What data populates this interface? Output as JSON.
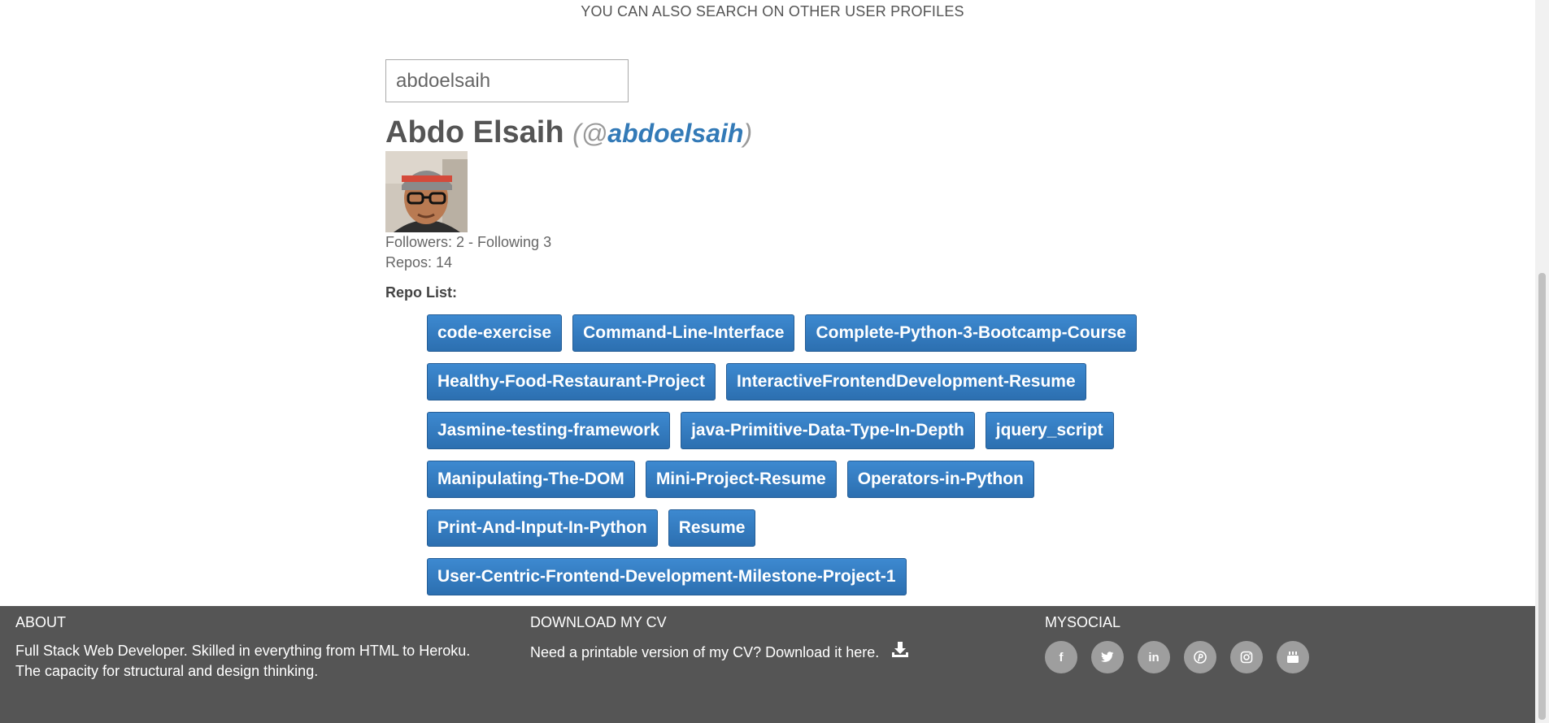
{
  "search": {
    "heading": "YOU CAN ALSO SEARCH ON OTHER USER PROFILES",
    "value": "abdoelsaih"
  },
  "profile": {
    "name": "Abdo Elsaih",
    "paren_open": "(@",
    "handle": "abdoelsaih",
    "paren_close": ")",
    "avatar_icon": "user-avatar-photo",
    "followers_text": "Followers: 2 - Following 3",
    "repos_text": "Repos: 14"
  },
  "repos": {
    "label": "Repo List:",
    "items": [
      "code-exercise",
      "Command-Line-Interface",
      "Complete-Python-3-Bootcamp-Course",
      "Healthy-Food-Restaurant-Project",
      "InteractiveFrontendDevelopment-Resume",
      "Jasmine-testing-framework",
      "java-Primitive-Data-Type-In-Depth",
      "jquery_script",
      "Manipulating-The-DOM",
      "Mini-Project-Resume",
      "Operators-in-Python",
      "Print-And-Input-In-Python",
      "Resume",
      "User-Centric-Frontend-Development-Milestone-Project-1"
    ]
  },
  "footer": {
    "about_title": "ABOUT",
    "about_text": "Full Stack Web Developer. Skilled in everything from HTML to Heroku. The capacity for structural and design thinking.",
    "cv_title": "DOWNLOAD MY CV",
    "cv_text": "Need a printable version of my CV? Download it here.",
    "social_title": "MYSOCIAL",
    "social": [
      {
        "name": "facebook",
        "glyph": "f"
      },
      {
        "name": "twitter",
        "glyph": "t"
      },
      {
        "name": "linkedin",
        "glyph": "in"
      },
      {
        "name": "pinterest",
        "glyph": "p"
      },
      {
        "name": "instagram",
        "glyph": ""
      },
      {
        "name": "youtube",
        "glyph": ""
      }
    ]
  },
  "colors": {
    "repo_button": "#337ab7",
    "link": "#337ab7",
    "footer_bg": "#555555",
    "social_circle": "#9e9e9e"
  }
}
